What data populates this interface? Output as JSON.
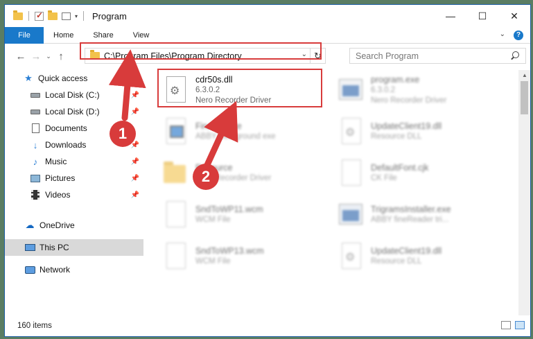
{
  "window": {
    "title": "Program",
    "controls": {
      "minimize": "—",
      "maximize": "☐",
      "close": "✕"
    }
  },
  "ribbon": {
    "tabs": [
      "File",
      "Home",
      "Share",
      "View"
    ]
  },
  "nav": {
    "address": "C:\\Program Files\\Program Directory",
    "search_placeholder": "Search Program"
  },
  "sidebar": {
    "items": [
      {
        "label": "Quick access",
        "icon": "star-icon"
      },
      {
        "label": "Local Disk (C:)",
        "icon": "drive-icon"
      },
      {
        "label": "Local Disk (D:)",
        "icon": "drive-icon"
      },
      {
        "label": "Documents",
        "icon": "documents-icon"
      },
      {
        "label": "Downloads",
        "icon": "download-icon"
      },
      {
        "label": "Music",
        "icon": "music-icon"
      },
      {
        "label": "Pictures",
        "icon": "pictures-icon"
      },
      {
        "label": "Videos",
        "icon": "videos-icon"
      },
      {
        "label": "OneDrive",
        "icon": "cloud-icon"
      },
      {
        "label": "This PC",
        "icon": "pc-icon"
      },
      {
        "label": "Network",
        "icon": "network-icon"
      }
    ]
  },
  "files": [
    {
      "name": "cdr50s.dll",
      "line2": "6.3.0.2",
      "line3": "Nero Recorder Driver",
      "icon": "dll-gear-icon"
    },
    {
      "name": "program.exe",
      "line2": "6.3.0.2",
      "line3": "Nero Recorder Driver",
      "icon": "exe-icon"
    },
    {
      "name": "Finalize.exe",
      "line2": "ABBY background exe",
      "line3": "",
      "icon": "window-file-icon"
    },
    {
      "name": "UpdateClient19.dll",
      "line2": "Resource DLL",
      "line3": "",
      "icon": "file-icon"
    },
    {
      "name": "Resource",
      "line2": "Nero Recorder Driver",
      "line3": "",
      "icon": "folder-icon"
    },
    {
      "name": "DefaultFont.cjk",
      "line2": "CK File",
      "line3": "",
      "icon": "file-icon"
    },
    {
      "name": "SndToWP11.wcm",
      "line2": "WCM File",
      "line3": "",
      "icon": "file-icon"
    },
    {
      "name": "TrigramsInstaller.exe",
      "line2": "ABBY fineReader tri...",
      "line3": "",
      "icon": "exe-icon"
    },
    {
      "name": "SndToWP13.wcm",
      "line2": "WCM File",
      "line3": "",
      "icon": "file-icon"
    },
    {
      "name": "UpdateClient19.dll",
      "line2": "Resource DLL",
      "line3": "",
      "icon": "file-icon"
    }
  ],
  "annotations": {
    "callout1": "1",
    "callout2": "2"
  },
  "status": {
    "count": "160 items"
  },
  "colors": {
    "accent": "#1979ca",
    "highlight": "#d83b3b"
  }
}
